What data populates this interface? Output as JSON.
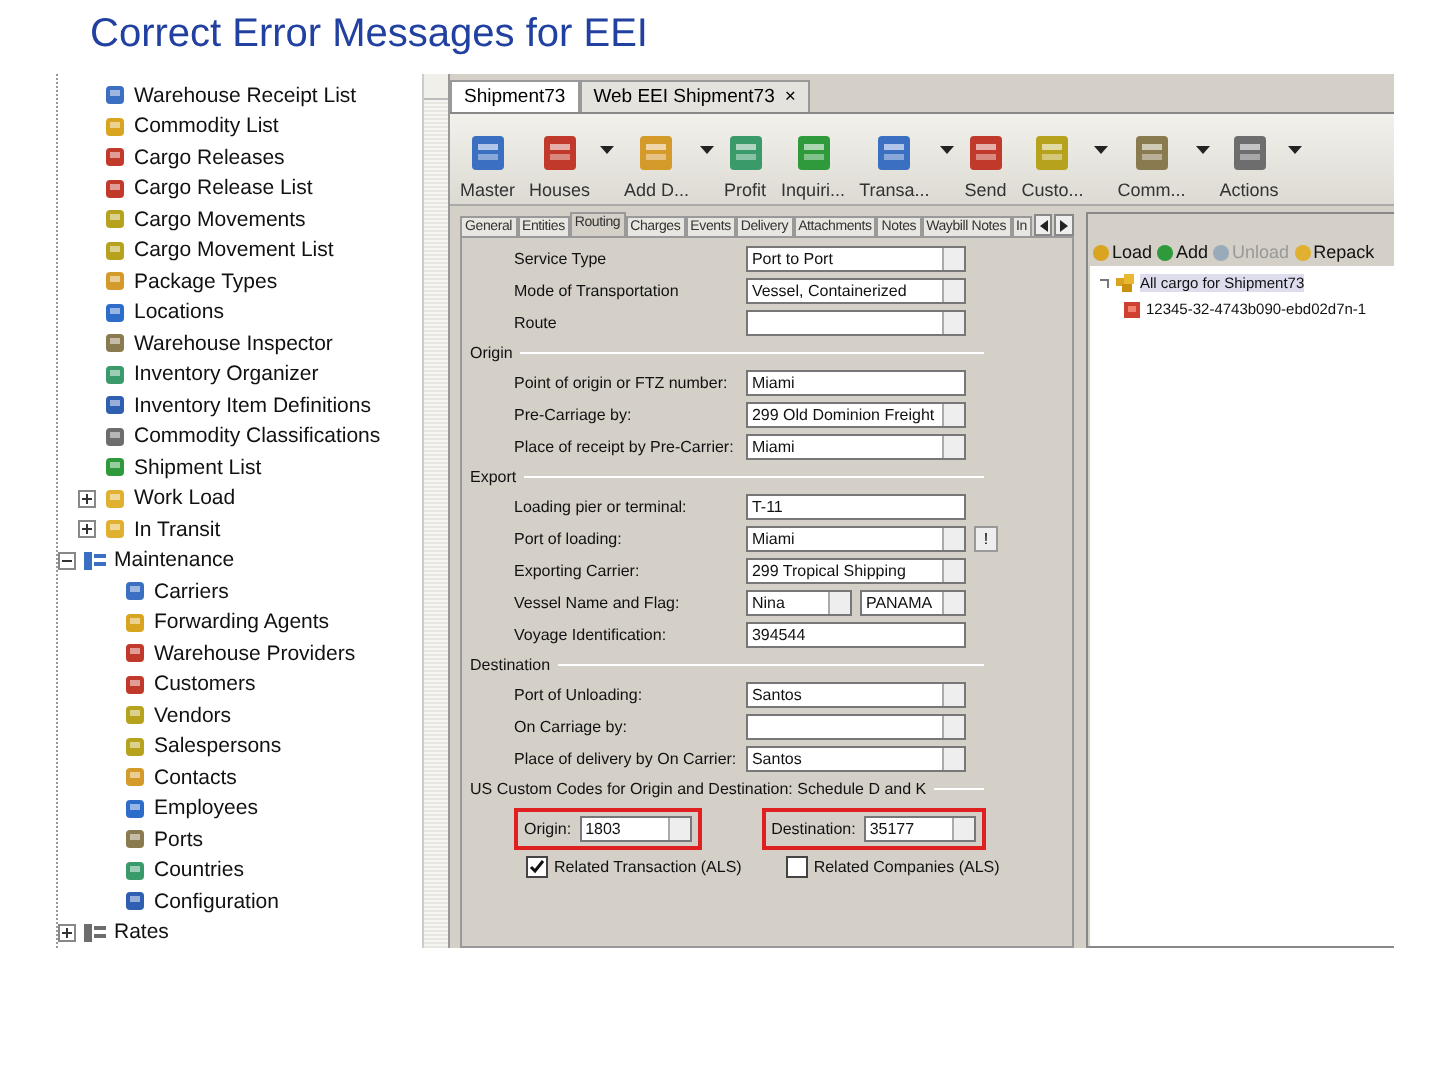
{
  "slide_title": "Correct Error Messages for EEI",
  "nav_tree": {
    "items": [
      {
        "kind": "item",
        "label": "Warehouse Receipt List"
      },
      {
        "kind": "item",
        "label": "Commodity List"
      },
      {
        "kind": "item",
        "label": "Cargo Releases"
      },
      {
        "kind": "item",
        "label": "Cargo Release List"
      },
      {
        "kind": "item",
        "label": "Cargo Movements"
      },
      {
        "kind": "item",
        "label": "Cargo Movement List"
      },
      {
        "kind": "item",
        "label": "Package Types"
      },
      {
        "kind": "item",
        "label": "Locations"
      },
      {
        "kind": "item",
        "label": "Warehouse Inspector"
      },
      {
        "kind": "item",
        "label": "Inventory Organizer"
      },
      {
        "kind": "item",
        "label": "Inventory Item Definitions"
      },
      {
        "kind": "item",
        "label": "Commodity Classifications"
      },
      {
        "kind": "item",
        "label": "Shipment List"
      },
      {
        "kind": "item",
        "label": "Work Load",
        "expanded": false
      },
      {
        "kind": "item",
        "label": "In Transit",
        "expanded": false
      },
      {
        "kind": "group",
        "label": "Maintenance",
        "expanded": true,
        "children": [
          {
            "kind": "item",
            "label": "Carriers"
          },
          {
            "kind": "item",
            "label": "Forwarding Agents"
          },
          {
            "kind": "item",
            "label": "Warehouse Providers"
          },
          {
            "kind": "item",
            "label": "Customers"
          },
          {
            "kind": "item",
            "label": "Vendors"
          },
          {
            "kind": "item",
            "label": "Salespersons"
          },
          {
            "kind": "item",
            "label": "Contacts"
          },
          {
            "kind": "item",
            "label": "Employees"
          },
          {
            "kind": "item",
            "label": "Ports"
          },
          {
            "kind": "item",
            "label": "Countries"
          },
          {
            "kind": "item",
            "label": "Configuration"
          }
        ]
      },
      {
        "kind": "group",
        "label": "Rates",
        "expanded": false
      }
    ]
  },
  "doc_tabs": [
    {
      "label": "Shipment73",
      "selected": true
    },
    {
      "label": "Web EEI Shipment73",
      "selected": false,
      "close": "×"
    }
  ],
  "toolbar": [
    {
      "label": "Master",
      "menu": false
    },
    {
      "label": "Houses",
      "menu": true
    },
    {
      "label": "Add D...",
      "menu": true
    },
    {
      "label": "Profit",
      "menu": false
    },
    {
      "label": "Inquiri...",
      "menu": false
    },
    {
      "label": "Transa...",
      "menu": true
    },
    {
      "label": "Send",
      "menu": false
    },
    {
      "label": "Custo...",
      "menu": true
    },
    {
      "label": "Comm...",
      "menu": true
    },
    {
      "label": "Actions",
      "menu": true
    }
  ],
  "form_tabs": [
    {
      "label": "General",
      "selected": false
    },
    {
      "label": "Entities",
      "selected": false
    },
    {
      "label": "Routing",
      "selected": true
    },
    {
      "label": "Charges",
      "selected": false
    },
    {
      "label": "Events",
      "selected": false
    },
    {
      "label": "Delivery",
      "selected": false
    },
    {
      "label": "Attachments",
      "selected": false
    },
    {
      "label": "Notes",
      "selected": false
    },
    {
      "label": "Waybill Notes",
      "selected": false
    },
    {
      "label": "In",
      "selected": false
    }
  ],
  "form": [
    {
      "kind": "field",
      "label": "Service Type",
      "fields": [
        {
          "kind": "select",
          "value": "Port to Port"
        }
      ]
    },
    {
      "kind": "field",
      "label": "Mode of Transportation",
      "fields": [
        {
          "kind": "select",
          "value": "Vessel, Containerized"
        }
      ]
    },
    {
      "kind": "field",
      "label": "Route",
      "fields": [
        {
          "kind": "select"
        }
      ]
    },
    {
      "kind": "section",
      "label": "Origin"
    },
    {
      "kind": "field",
      "label": "Point of origin or FTZ number:",
      "fields": [
        {
          "kind": "text",
          "value": "Miami"
        }
      ]
    },
    {
      "kind": "field",
      "label": "Pre-Carriage by:",
      "fields": [
        {
          "kind": "select",
          "value": "299 Old Dominion Freight"
        }
      ]
    },
    {
      "kind": "field",
      "label": "Place of receipt by Pre-Carrier:",
      "fields": [
        {
          "kind": "select",
          "value": "Miami"
        }
      ]
    },
    {
      "kind": "section",
      "label": "Export"
    },
    {
      "kind": "field",
      "label": "Loading pier or terminal:",
      "fields": [
        {
          "kind": "text",
          "value": "T-11"
        }
      ]
    },
    {
      "kind": "field",
      "label": "Port of loading:",
      "fields": [
        {
          "kind": "select",
          "value": "Miami"
        }
      ],
      "extra_button": "!"
    },
    {
      "kind": "field",
      "label": "Exporting Carrier:",
      "fields": [
        {
          "kind": "select",
          "value": "299 Tropical Shipping"
        }
      ]
    },
    {
      "kind": "field",
      "label": "Vessel Name and Flag:",
      "fields": [
        {
          "kind": "select",
          "value": "Nina",
          "half": true
        },
        {
          "kind": "select",
          "value": "PANAMA",
          "half": true
        }
      ]
    },
    {
      "kind": "field",
      "label": "Voyage Identification:",
      "fields": [
        {
          "kind": "text",
          "value": "394544"
        }
      ]
    },
    {
      "kind": "section",
      "label": "Destination"
    },
    {
      "kind": "field",
      "label": "Port of Unloading:",
      "fields": [
        {
          "kind": "select",
          "value": "Santos"
        }
      ]
    },
    {
      "kind": "field",
      "label": "On Carriage by:",
      "fields": [
        {
          "kind": "select"
        }
      ]
    },
    {
      "kind": "field",
      "label": "Place of delivery by On Carrier:",
      "fields": [
        {
          "kind": "select",
          "value": "Santos"
        }
      ]
    },
    {
      "kind": "section",
      "label": "US Custom Codes for Origin and Destination: Schedule D and K"
    }
  ],
  "codes": [
    {
      "label": "Origin:",
      "value": "1803",
      "highlighted": true
    },
    {
      "label": "Destination:",
      "value": "35177",
      "highlighted": true
    }
  ],
  "checkboxes": [
    {
      "label": "Related Transaction (ALS)",
      "checked": true
    },
    {
      "label": "Related Companies (ALS)",
      "checked": false
    }
  ],
  "cargo": {
    "actions": [
      {
        "label": "Load",
        "disabled": false
      },
      {
        "label": "Add",
        "disabled": false
      },
      {
        "label": "Unload",
        "disabled": true
      },
      {
        "label": "Repack",
        "disabled": false
      }
    ],
    "tree": {
      "label": "All cargo for Shipment73",
      "expanded": true,
      "children": [
        {
          "label": "12345-32-4743b090-ebd02d7n-1"
        }
      ]
    }
  }
}
